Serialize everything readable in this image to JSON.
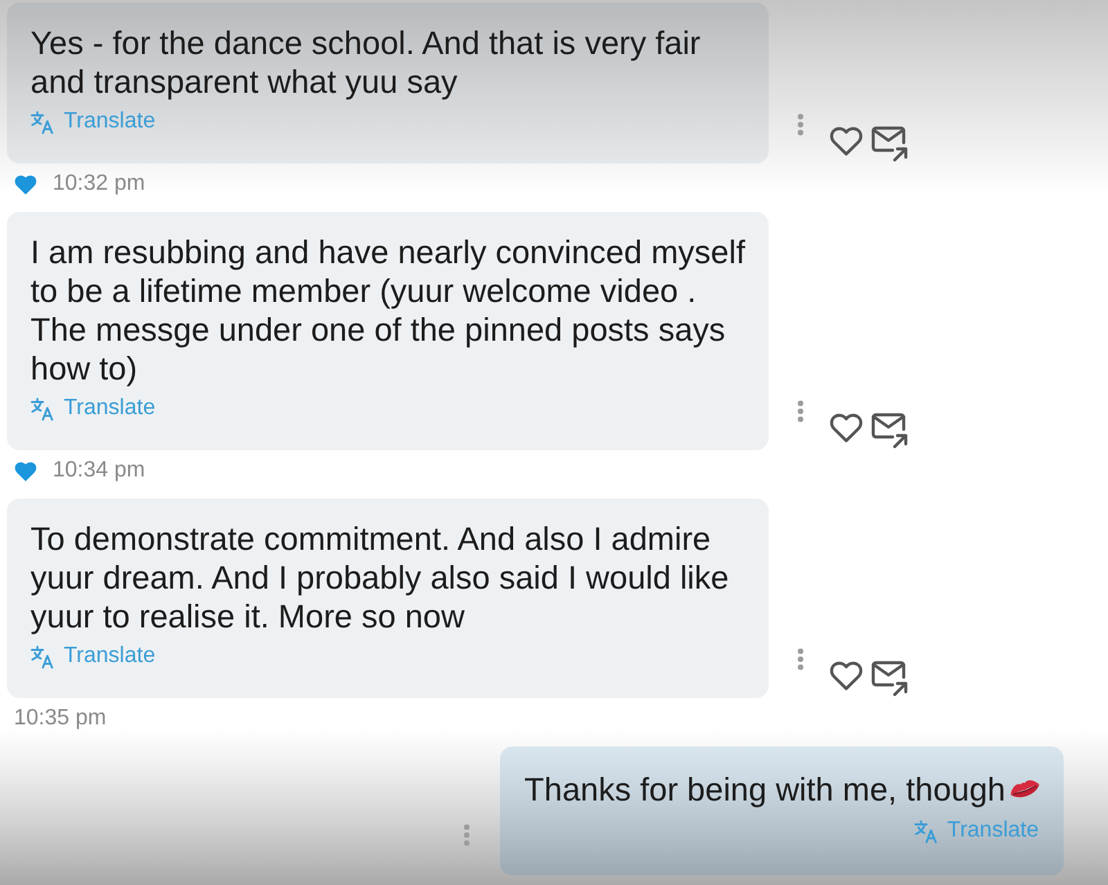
{
  "messages": [
    {
      "kind": "incoming",
      "text": "Yes - for the dance school. And that is very fair and transparent what yuu say",
      "translate": "Translate",
      "liked": true,
      "time": "10:32 pm"
    },
    {
      "kind": "incoming",
      "text": "I am resubbing and have nearly convinced myself to be a lifetime member (yuur welcome video . The messge under one of the pinned posts says how to)",
      "translate": "Translate",
      "liked": true,
      "time": "10:34 pm"
    },
    {
      "kind": "incoming",
      "text": "To demonstrate commitment. And also I admire yuur dream. And I probably also said I would like yuur to realise it. More so now",
      "translate": "Translate",
      "liked": false,
      "time": "10:35 pm"
    },
    {
      "kind": "outgoing",
      "text": "Thanks for being with me, though",
      "translate": "Translate"
    }
  ]
}
